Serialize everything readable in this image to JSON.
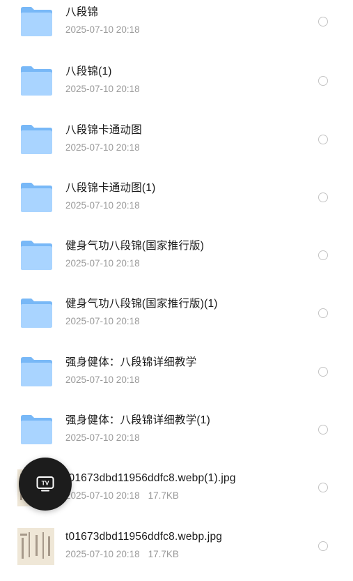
{
  "files": [
    {
      "type": "folder",
      "name": "八段锦",
      "date": "2025-07-10 20:18",
      "size": ""
    },
    {
      "type": "folder",
      "name": "八段锦(1)",
      "date": "2025-07-10 20:18",
      "size": ""
    },
    {
      "type": "folder",
      "name": "八段锦卡通动图",
      "date": "2025-07-10 20:18",
      "size": ""
    },
    {
      "type": "folder",
      "name": "八段锦卡通动图(1)",
      "date": "2025-07-10 20:18",
      "size": ""
    },
    {
      "type": "folder",
      "name": "健身气功八段锦(国家推行版)",
      "date": "2025-07-10 20:18",
      "size": ""
    },
    {
      "type": "folder",
      "name": "健身气功八段锦(国家推行版)(1)",
      "date": "2025-07-10 20:18",
      "size": ""
    },
    {
      "type": "folder",
      "name": "强身健体：八段锦详细教学",
      "date": "2025-07-10 20:18",
      "size": ""
    },
    {
      "type": "folder",
      "name": "强身健体：八段锦详细教学(1)",
      "date": "2025-07-10 20:18",
      "size": ""
    },
    {
      "type": "image",
      "name": "t01673dbd11956ddfc8.webp(1).jpg",
      "date": "2025-07-10 20:18",
      "size": "17.7KB"
    },
    {
      "type": "image",
      "name": "t01673dbd11956ddfc8.webp.jpg",
      "date": "2025-07-10 20:18",
      "size": "17.7KB"
    }
  ],
  "floating_button": {
    "label": "TV",
    "icon": "tv-icon"
  },
  "colors": {
    "folder_light": "#a9d4ff",
    "folder_dark": "#6cb0f5",
    "text_primary": "#1a1a1a",
    "text_secondary": "#9a9a9a",
    "radio_border": "#c4c4c4",
    "fab_bg": "#1c1c1c"
  }
}
